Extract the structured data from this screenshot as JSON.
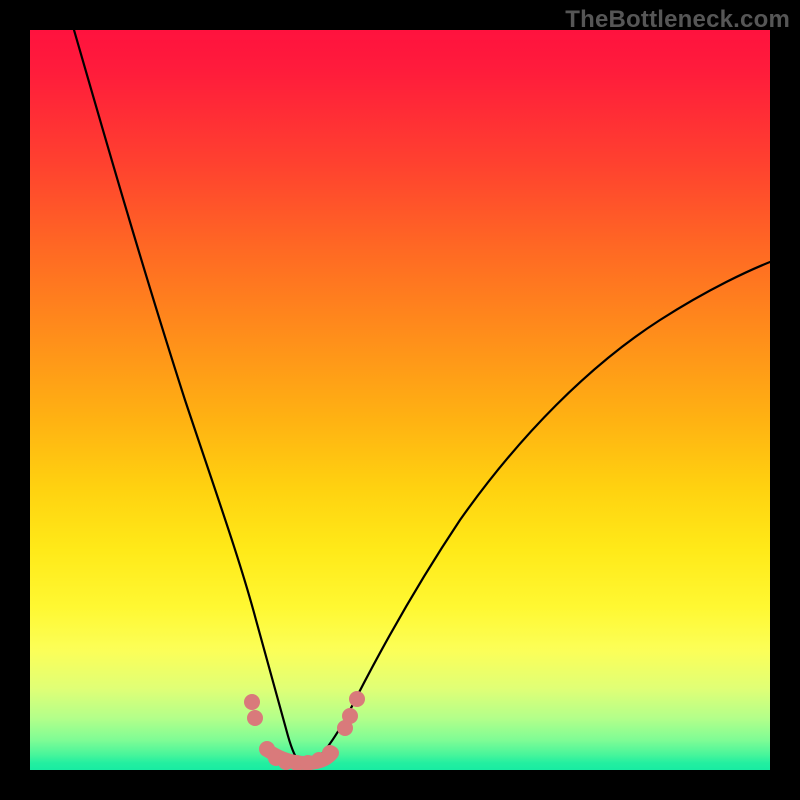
{
  "watermark": "TheBottleneck.com",
  "colors": {
    "frame": "#000000",
    "curve": "#000000",
    "bead": "#d97a7b",
    "gradient_top": "#ff123e",
    "gradient_bottom": "#18eca2"
  },
  "chart_data": {
    "type": "line",
    "title": "",
    "xlabel": "",
    "ylabel": "",
    "xlim": [
      0,
      100
    ],
    "ylim": [
      0,
      100
    ],
    "series": [
      {
        "name": "left-curve",
        "x": [
          6,
          10,
          14,
          18,
          22,
          25,
          27,
          29,
          30.5,
          32,
          33,
          34,
          35,
          36
        ],
        "y": [
          100,
          82,
          65,
          50,
          36,
          24,
          16,
          10,
          6,
          3.5,
          2.2,
          1.4,
          1.0,
          0.9
        ]
      },
      {
        "name": "right-curve",
        "x": [
          38,
          40,
          43,
          47,
          52,
          58,
          65,
          73,
          82,
          92,
          100
        ],
        "y": [
          0.9,
          1.8,
          4.5,
          10,
          18,
          27,
          36,
          45,
          53,
          60,
          65
        ]
      }
    ],
    "annotations": {
      "bead_cluster": {
        "description": "salmon colored rounded markers near valley of the V curve",
        "points_plotcoords": [
          {
            "x": 30.0,
            "y": 9.0
          },
          {
            "x": 30.3,
            "y": 7.0
          },
          {
            "x": 32.0,
            "y": 2.8
          },
          {
            "x": 33.2,
            "y": 1.5
          },
          {
            "x": 34.5,
            "y": 1.0
          },
          {
            "x": 36.0,
            "y": 0.9
          },
          {
            "x": 37.5,
            "y": 0.9
          },
          {
            "x": 39.0,
            "y": 1.2
          },
          {
            "x": 40.5,
            "y": 2.2
          },
          {
            "x": 42.5,
            "y": 5.5
          },
          {
            "x": 43.2,
            "y": 7.2
          },
          {
            "x": 44.2,
            "y": 9.5
          }
        ]
      }
    }
  }
}
